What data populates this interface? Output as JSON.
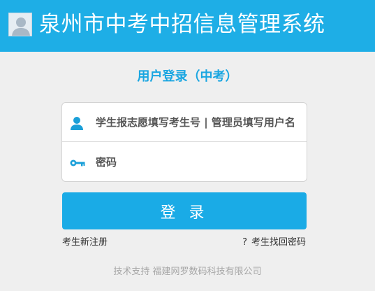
{
  "header": {
    "title": "泉州市中考中招信息管理系统",
    "icon": "user-avatar-icon",
    "background_color": "#1eaee6"
  },
  "login": {
    "heading": "用户登录（中考）",
    "username": {
      "icon": "user-icon",
      "placeholder": "学生报志愿填写考生号 | 管理员填写用户名"
    },
    "password": {
      "icon": "key-icon",
      "placeholder": "密码"
    },
    "submit_label": "登 录",
    "accent_color": "#1aabe6"
  },
  "links": {
    "register": "考生新注册",
    "recover_mark": "?",
    "recover": "考生找回密码"
  },
  "footer": {
    "text": "技术支持 福建网罗数码科技有限公司"
  }
}
